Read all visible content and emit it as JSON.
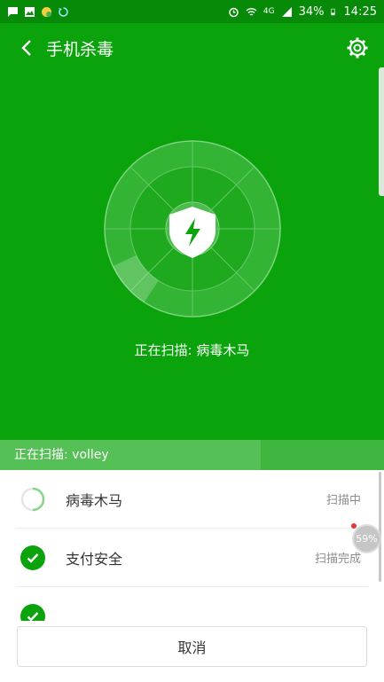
{
  "status_bar": {
    "network": "4G",
    "battery": "34%",
    "time": "14:25",
    "left_icons": [
      "message-icon",
      "image-icon",
      "app-icon",
      "sync-icon"
    ],
    "right_icons": [
      "alarm-icon",
      "wifi-icon",
      "signal-icon",
      "battery-icon"
    ]
  },
  "header": {
    "title": "手机杀毒"
  },
  "scanner": {
    "caption": "正在扫描: 病毒木马",
    "progress_fraction": 0.68
  },
  "progress": {
    "text": "正在扫描: volley"
  },
  "list": {
    "items": [
      {
        "label": "病毒木马",
        "status": "扫描中",
        "state": "scanning"
      },
      {
        "label": "支付安全",
        "status": "扫描完成",
        "state": "done"
      },
      {
        "label": "",
        "status": "",
        "state": "done"
      }
    ]
  },
  "float_badge": {
    "text": "59%"
  },
  "footer": {
    "cancel_label": "取消"
  },
  "colors": {
    "primary_green": "#0aa30b",
    "status_bar": "#078a07",
    "progress_strip": "#3fb63f"
  }
}
